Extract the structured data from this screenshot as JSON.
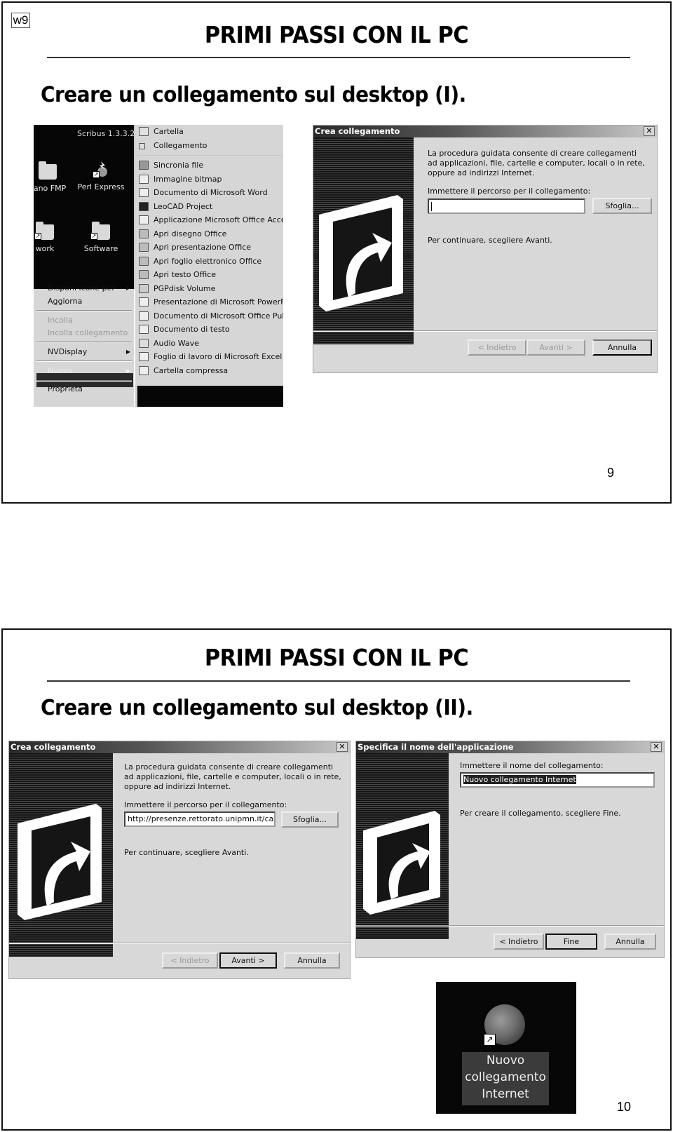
{
  "slide1": {
    "tag": "w9",
    "title": "PRIMI PASSI CON IL PC",
    "subtitle": "Creare un collegamento sul desktop (I).",
    "page_number": "9",
    "desktop": {
      "top_label": "Scribus 1.3.3.2",
      "icons": [
        {
          "label": "liano FMP",
          "icon": "folder-icon"
        },
        {
          "label": "Perl Express",
          "icon": "perl-express-icon"
        },
        {
          "label": "work",
          "icon": "folder-shortcut-icon"
        },
        {
          "label": "Software",
          "icon": "folder-shortcut-icon"
        }
      ],
      "context_menu": [
        {
          "label": "Disponi icone per",
          "submenu": true,
          "disabled": false
        },
        {
          "label": "Aggiorna",
          "submenu": false,
          "disabled": false
        },
        {
          "label": "Incolla",
          "submenu": false,
          "disabled": true
        },
        {
          "label": "Incolla collegamento",
          "submenu": false,
          "disabled": true
        },
        {
          "label": "NVDisplay",
          "submenu": true,
          "disabled": false
        },
        {
          "label": "Nuovo",
          "submenu": true,
          "disabled": false,
          "highlighted": true
        },
        {
          "label": "Proprietà",
          "submenu": false,
          "disabled": false
        }
      ],
      "submenu_arrow": "▶",
      "new_submenu": [
        {
          "label": "Cartella",
          "icon": "folder-icon"
        },
        {
          "label": "Collegamento",
          "icon": "shortcut-icon"
        },
        {
          "label": "Sincronia file",
          "icon": "briefcase-icon"
        },
        {
          "label": "Immagine bitmap",
          "icon": "bitmap-icon"
        },
        {
          "label": "Documento di Microsoft Word",
          "icon": "word-doc-icon"
        },
        {
          "label": "LeoCAD Project",
          "icon": "leocad-icon"
        },
        {
          "label": "Applicazione Microsoft Office Access",
          "icon": "access-icon"
        },
        {
          "label": "Apri disegno Office",
          "icon": "office-drawing-icon"
        },
        {
          "label": "Apri presentazione Office",
          "icon": "office-presentation-icon"
        },
        {
          "label": "Apri foglio elettronico Office",
          "icon": "office-spreadsheet-icon"
        },
        {
          "label": "Apri testo Office",
          "icon": "office-text-icon"
        },
        {
          "label": "PGPdisk Volume",
          "icon": "pgpdisk-icon"
        },
        {
          "label": "Presentazione di Microsoft PowerPoint",
          "icon": "powerpoint-icon"
        },
        {
          "label": "Documento di Microsoft Office Publisher",
          "icon": "publisher-icon"
        },
        {
          "label": "Documento di testo",
          "icon": "text-doc-icon"
        },
        {
          "label": "Audio Wave",
          "icon": "audio-wave-icon"
        },
        {
          "label": "Foglio di lavoro di Microsoft Excel",
          "icon": "excel-icon"
        },
        {
          "label": "Cartella compressa",
          "icon": "zip-folder-icon"
        }
      ]
    },
    "wizard": {
      "title": "Crea collegamento",
      "close": "✕",
      "intro": "La procedura guidata consente di creare collegamenti ad applicazioni, file, cartelle e computer, locali o in rete, oppure ad indirizzi Internet.",
      "path_label": "Immettere il percorso per il collegamento:",
      "path_value": "",
      "browse": "Sfoglia...",
      "continue_text": "Per continuare, scegliere Avanti.",
      "back": "< Indietro",
      "next": "Avanti >",
      "cancel": "Annulla",
      "back_disabled": true,
      "next_disabled": true
    }
  },
  "slide2": {
    "title": "PRIMI PASSI CON IL PC",
    "subtitle": "Creare un collegamento sul desktop (II).",
    "page_number": "10",
    "wizard1": {
      "title": "Crea collegamento",
      "close": "✕",
      "intro": "La procedura guidata consente di creare collegamenti ad applicazioni, file, cartelle e computer, locali o in rete, oppure ad indirizzi Internet.",
      "path_label": "Immettere il percorso per il collegamento:",
      "path_value": "http://presenze.rettorato.unipmn.it/car",
      "browse": "Sfoglia...",
      "continue_text": "Per continuare, scegliere Avanti.",
      "back": "< Indietro",
      "next": "Avanti >",
      "cancel": "Annulla",
      "back_disabled": true
    },
    "wizard2": {
      "title": "Specifica il nome dell'applicazione",
      "close": "✕",
      "name_label": "Immettere il nome del collegamento:",
      "name_value": "Nuovo collegamento Internet",
      "finish_text": "Per creare il collegamento, scegliere Fine.",
      "back": "< Indietro",
      "finish": "Fine",
      "cancel": "Annulla"
    },
    "result_icon": {
      "icon": "firefox-icon",
      "shortcut_glyph": "↗",
      "label_lines": [
        "Nuovo",
        "collegamento",
        "Internet"
      ]
    }
  }
}
